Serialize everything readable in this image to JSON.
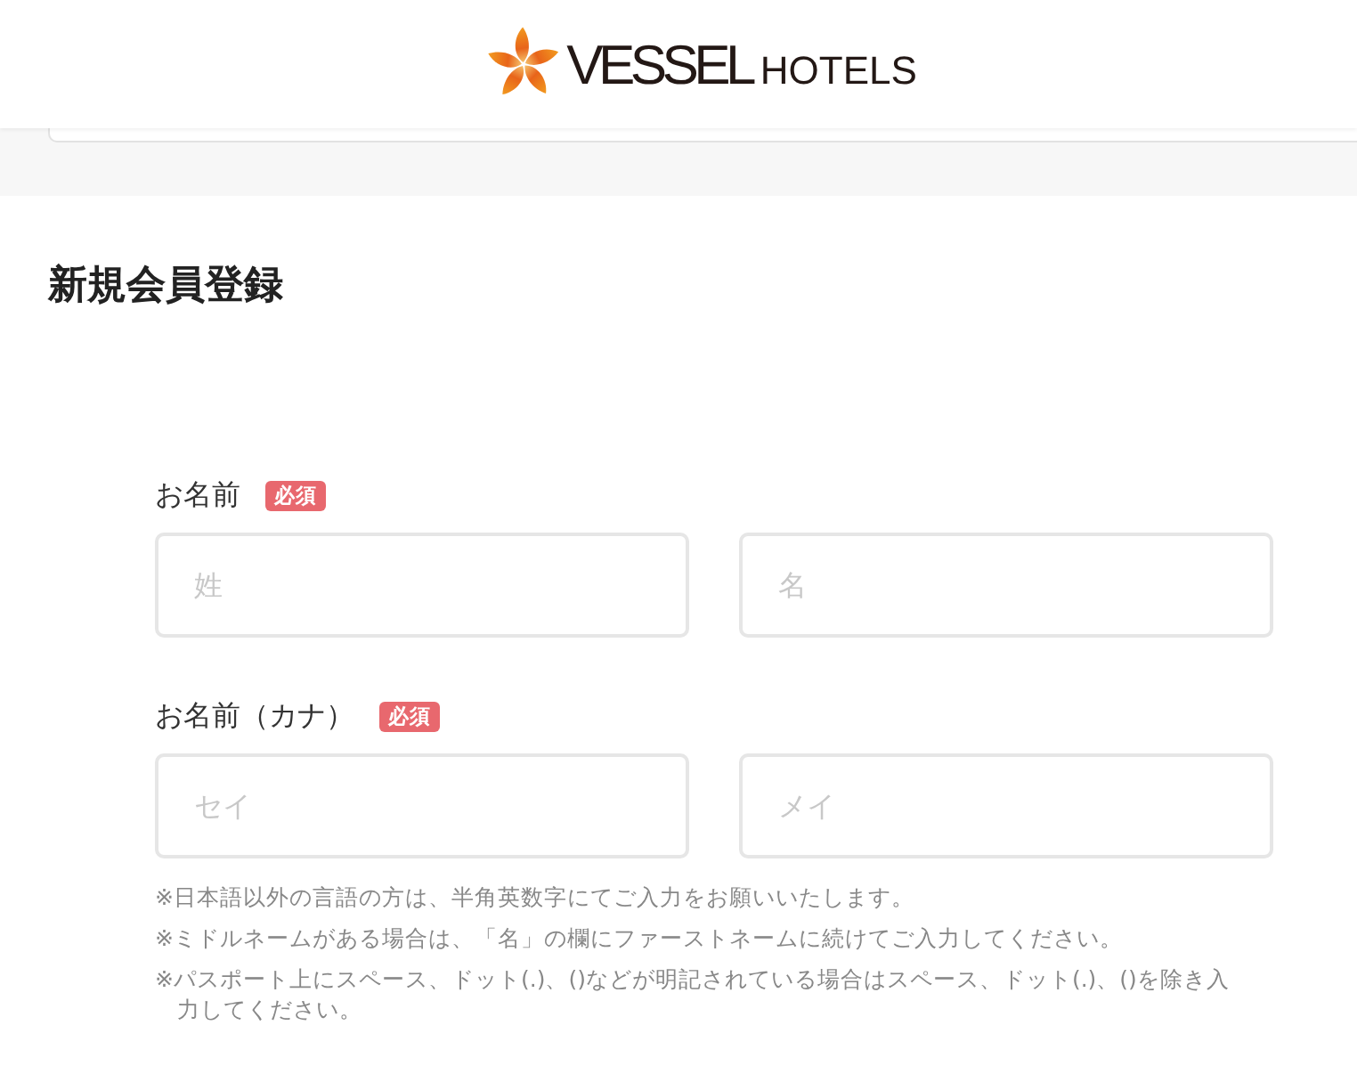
{
  "header": {
    "logo": {
      "brand": "VESSEL",
      "suffix": "HOTELS"
    }
  },
  "page_title": "新規会員登録",
  "fields": [
    {
      "label": "お名前",
      "badge": "必須",
      "inputs": [
        {
          "placeholder": "姓"
        },
        {
          "placeholder": "名"
        }
      ]
    },
    {
      "label": "お名前（カナ）",
      "badge": "必須",
      "inputs": [
        {
          "placeholder": "セイ"
        },
        {
          "placeholder": "メイ"
        }
      ]
    }
  ],
  "notes": [
    "※日本語以外の言語の方は、半角英数字にてご入力をお願いいたします。",
    "※ミドルネームがある場合は、「名」の欄にファーストネームに続けてご入力してください。",
    "※パスポート上にスペース、ドット(.)、()などが明記されている場合はスペース、ドット(.)、()を除き入力してください。"
  ]
}
